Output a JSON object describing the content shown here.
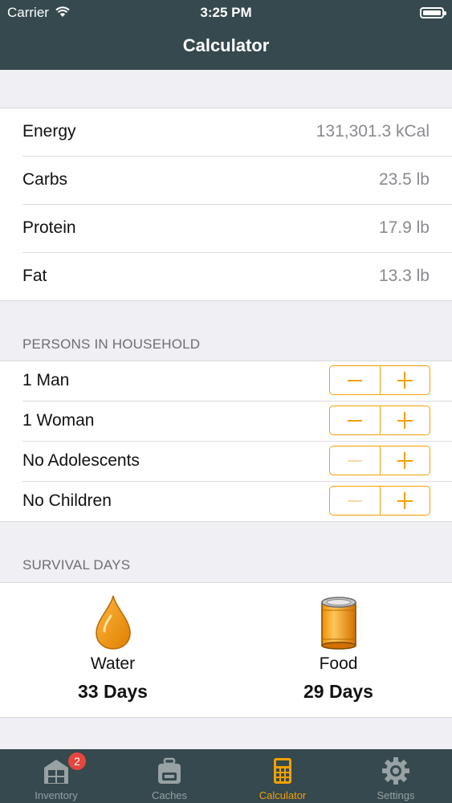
{
  "status_bar": {
    "carrier": "Carrier",
    "time": "3:25 PM"
  },
  "nav": {
    "title": "Calculator"
  },
  "nutrition": [
    {
      "label": "Energy",
      "value": "131,301.3 kCal"
    },
    {
      "label": "Carbs",
      "value": "23.5 lb"
    },
    {
      "label": "Protein",
      "value": "17.9 lb"
    },
    {
      "label": "Fat",
      "value": "13.3 lb"
    }
  ],
  "persons": {
    "header": "PERSONS IN HOUSEHOLD",
    "rows": [
      {
        "label": "1 Man",
        "minus_enabled": true
      },
      {
        "label": "1 Woman",
        "minus_enabled": true
      },
      {
        "label": "No Adolescents",
        "minus_enabled": false
      },
      {
        "label": "No Children",
        "minus_enabled": false
      }
    ]
  },
  "survival": {
    "header": "SURVIVAL DAYS",
    "water": {
      "icon": "water-drop-icon",
      "label": "Water",
      "days": "33 Days"
    },
    "food": {
      "icon": "food-can-icon",
      "label": "Food",
      "days": "29 Days"
    }
  },
  "tabbar": {
    "items": [
      {
        "label": "Inventory",
        "icon": "inventory-boxes-icon",
        "badge": "2"
      },
      {
        "label": "Caches",
        "icon": "cache-backpack-icon"
      },
      {
        "label": "Calculator",
        "icon": "calculator-icon",
        "active": true
      },
      {
        "label": "Settings",
        "icon": "gear-icon"
      }
    ]
  },
  "colors": {
    "nav": "#35494e",
    "accent": "#f4a000",
    "badge": "#e5473f"
  }
}
